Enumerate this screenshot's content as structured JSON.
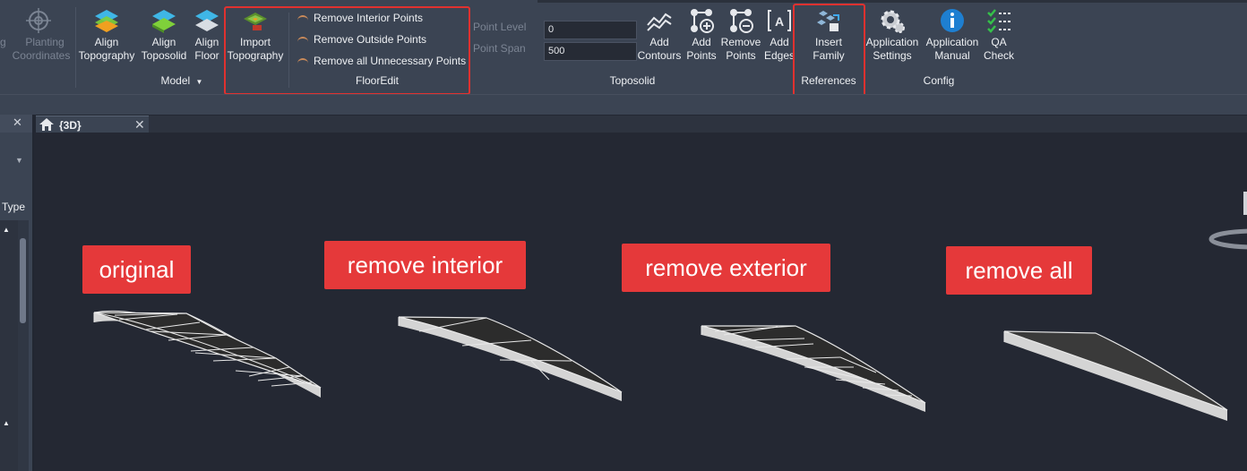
{
  "ribbon": {
    "planting": {
      "line1": "g",
      "label1": "Planting",
      "label2": "Coordinates"
    },
    "model_tools": [
      {
        "line1": "Align",
        "line2": "Topography",
        "icon": "align-topography-icon"
      },
      {
        "line1": "Align",
        "line2": "Toposolid",
        "icon": "align-toposolid-icon"
      },
      {
        "line1": "Align",
        "line2": "Floor",
        "icon": "align-floor-icon"
      }
    ],
    "model_group_label": "Model",
    "import": {
      "line1": "Import",
      "line2": "Topography"
    },
    "flooredit_cmds": [
      "Remove Interior Points",
      "Remove Outside Points",
      "Remove all Unnecessary Points"
    ],
    "flooredit_group_label": "FloorEdit",
    "point_level": {
      "label": "Point Level",
      "value": "0"
    },
    "point_span": {
      "label": "Point Span",
      "value": "500"
    },
    "toposolid_tools": [
      {
        "line1": "Add",
        "line2": "Contours",
        "icon": "add-contours-icon"
      },
      {
        "line1": "Add",
        "line2": "Points",
        "icon": "add-points-icon"
      },
      {
        "line1": "Remove",
        "line2": "Points",
        "icon": "remove-points-icon"
      },
      {
        "line1": "Add",
        "line2": "Edges",
        "icon": "add-edges-icon"
      }
    ],
    "toposolid_group_label": "Toposolid",
    "insert_family": {
      "line1": "Insert",
      "line2": "Family"
    },
    "references_group_label": "References",
    "config_tools": [
      {
        "line1": "Application",
        "line2": "Settings",
        "icon": "gear-icon"
      },
      {
        "line1": "Application",
        "line2": "Manual",
        "icon": "info-icon"
      },
      {
        "line1": "QA",
        "line2": "Check",
        "icon": "checklist-icon"
      }
    ],
    "config_group_label": "Config"
  },
  "left_panel": {
    "type_label": "Type"
  },
  "view_tab": {
    "title": "{3D}"
  },
  "callouts": [
    "original",
    "remove interior",
    "remove exterior",
    "remove all"
  ],
  "colors": {
    "highlight": "#e0312f",
    "callout_bg": "#e5393a",
    "slab_top": "#2c2c2c",
    "slab_edge": "#d4d4d4",
    "viewport_bg": "#242833"
  }
}
